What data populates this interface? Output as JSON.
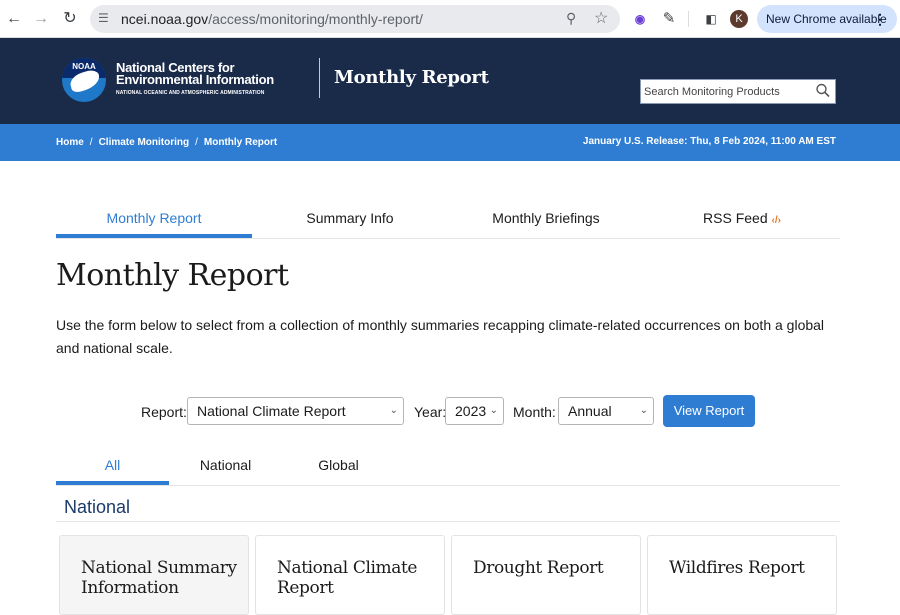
{
  "browser": {
    "url_host": "ncei.noaa.gov",
    "url_path": "/access/monitoring/monthly-report/",
    "avatar_letter": "K",
    "new_chrome_label": "New Chrome available"
  },
  "header": {
    "logo_text": "NOAA",
    "org_line1": "National Centers for",
    "org_line2": "Environmental Information",
    "org_sub": "NATIONAL OCEANIC AND ATMOSPHERIC ADMINISTRATION",
    "site_title": "Monthly Report",
    "search_placeholder": "Search Monitoring Products"
  },
  "breadcrumb": {
    "items": [
      "Home",
      "Climate Monitoring",
      "Monthly Report"
    ],
    "separator": "/",
    "release": "January U.S. Release: Thu, 8 Feb 2024, 11:00 AM EST"
  },
  "tabs": [
    {
      "label": "Monthly Report",
      "active": true
    },
    {
      "label": "Summary Info",
      "active": false
    },
    {
      "label": "Monthly Briefings",
      "active": false
    },
    {
      "label": "RSS Feed",
      "active": false
    }
  ],
  "page": {
    "title": "Monthly Report",
    "intro": "Use the form below to select from a collection of monthly summaries recapping climate-related occurrences on both a global and national scale."
  },
  "form": {
    "report_label": "Report:",
    "report_value": "National Climate Report",
    "year_label": "Year:",
    "year_value": "2023",
    "month_label": "Month:",
    "month_value": "Annual",
    "submit_label": "View Report"
  },
  "filters": [
    {
      "label": "All",
      "active": true
    },
    {
      "label": "National",
      "active": false
    },
    {
      "label": "Global",
      "active": false
    }
  ],
  "section": {
    "heading": "National"
  },
  "cards": [
    {
      "title": "National Summary Information"
    },
    {
      "title": "National Climate Report"
    },
    {
      "title": "Drought Report"
    },
    {
      "title": "Wildfires Report"
    }
  ],
  "colors": {
    "header_bg": "#1a2b4a",
    "accent": "#2f7dd3",
    "rss": "#e0792f"
  }
}
